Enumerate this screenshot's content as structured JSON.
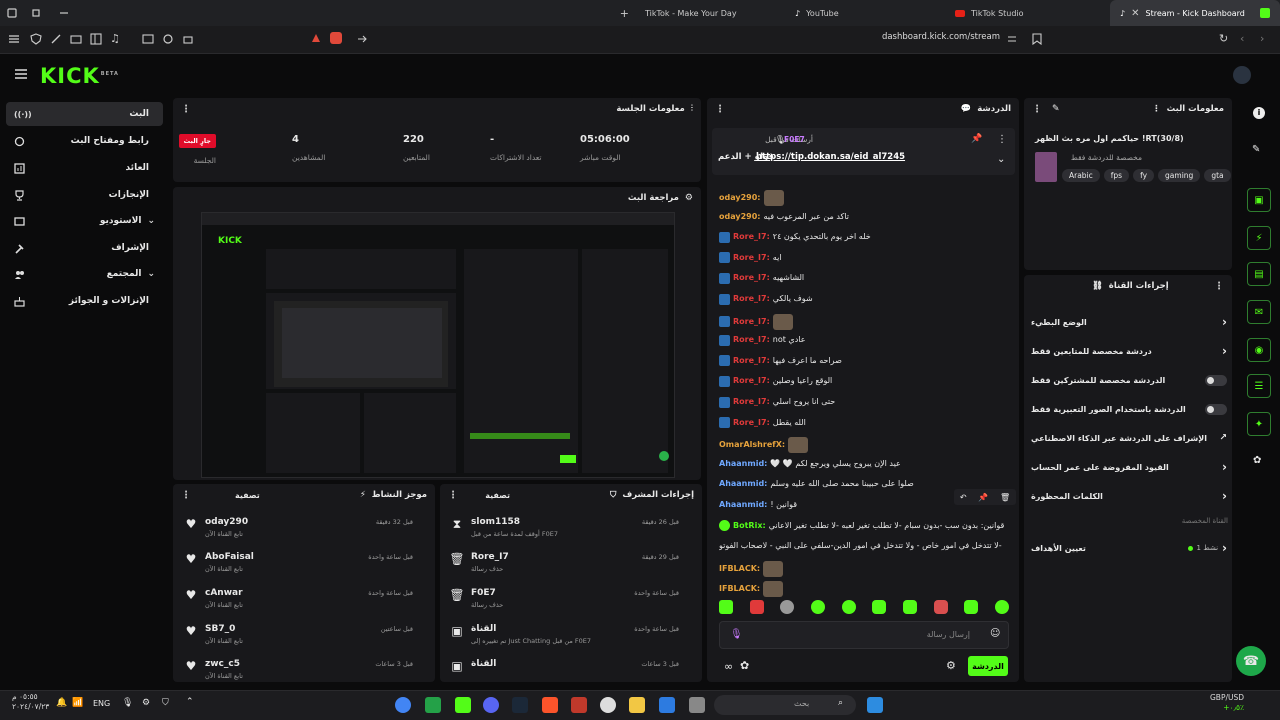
{
  "browser": {
    "tabs": [
      {
        "title": "TikTok - Make Your Day"
      },
      {
        "title": "YouTube"
      },
      {
        "title": "TikTok Studio"
      },
      {
        "title": "Stream - Kick Dashboard"
      }
    ],
    "url": "dashboard.kick.com/stream"
  },
  "brand": {
    "logo": "KICK",
    "beta": "BETA",
    "accent": "#53fc18"
  },
  "nav": {
    "items": [
      {
        "label": "البث",
        "icon": "live-icon"
      },
      {
        "label": "رابط ومفتاح البث",
        "icon": "link-icon"
      },
      {
        "label": "العائد",
        "icon": "chart-icon"
      },
      {
        "label": "الإنجازات",
        "icon": "trophy-icon"
      },
      {
        "label": "الاستوديو",
        "icon": "studio-icon"
      },
      {
        "label": "الإشراف",
        "icon": "hammer-icon"
      },
      {
        "label": "المجتمع",
        "icon": "community-icon"
      },
      {
        "label": "الإنزالات و الجوائز",
        "icon": "drops-icon"
      }
    ]
  },
  "session": {
    "title": "معلومات الجلسة",
    "live_badge": "جارٍ البث",
    "session_label": "الجلسة",
    "viewers_value": "4",
    "viewers_label": "المشاهدين",
    "followers_value": "220",
    "followers_label": "المتابعين",
    "subs_value": "-",
    "subs_label": "تعداد الاشتراكات",
    "uptime_value": "05:06:00",
    "uptime_label": "الوقت مباشر"
  },
  "preview": {
    "title": "مراجعة البث"
  },
  "activity": {
    "title": "موجز النشاط",
    "filter": "تصفية",
    "rows": [
      {
        "name": "oday290",
        "sub": "تابع القناة الآن",
        "time": "قبل 32 دقيقة"
      },
      {
        "name": "AboFaisal",
        "sub": "تابع القناة الآن",
        "time": "قبل ساعة واحدة"
      },
      {
        "name": "cAnwar",
        "sub": "تابع القناة الآن",
        "time": "قبل ساعة واحدة"
      },
      {
        "name": "SB7_0",
        "sub": "تابع القناة الآن",
        "time": "قبل ساعتين"
      },
      {
        "name": "zwc_c5",
        "sub": "تابع القناة الآن",
        "time": "قبل 3 ساعات"
      }
    ]
  },
  "modactions": {
    "title": "إجراءات المشرف",
    "filter": "تصفية",
    "rows": [
      {
        "name": "slom1158",
        "sub": "أوقف لمدة ساعة من قبل F0E7",
        "time": "قبل 26 دقيقة",
        "icon": "hourglass-icon"
      },
      {
        "name": "Rore_I7",
        "sub": "حذف رسالة",
        "time": "قبل 29 دقيقة",
        "icon": "trash-icon"
      },
      {
        "name": "F0E7",
        "sub": "حذف رسالة",
        "time": "قبل ساعة واحدة",
        "icon": "trash-icon"
      },
      {
        "name": "القناة",
        "sub": "تم تغييره إلى Just Chatting من قبل F0E7",
        "time": "قبل ساعة واحدة",
        "icon": "category-icon"
      },
      {
        "name": "القناة",
        "sub": "",
        "time": "قبل 3 ساعات",
        "icon": "category-icon"
      }
    ]
  },
  "chat": {
    "title": "الدردشة",
    "pinned": {
      "by": "أرسلت من قبل",
      "user": "F0E7",
      "text": "قولو + الدعم",
      "link": "https://tip.dokan.sa/eid_al7245"
    },
    "messages": [
      {
        "user": "oday290:",
        "text": "",
        "color": "#e6a23c",
        "badge": false
      },
      {
        "user": "oday290:",
        "text": "تاكد من عبر المرعوب فيه",
        "color": "#e6a23c",
        "badge": false
      },
      {
        "user": "Rore_I7:",
        "text": "خله اخر يوم بالتحدي يكون ٢٤",
        "color": "#e03a3a",
        "badge": true
      },
      {
        "user": "Rore_I7:",
        "text": "ايه",
        "color": "#e03a3a",
        "badge": true
      },
      {
        "user": "Rore_I7:",
        "text": "الشاشهيه",
        "color": "#e03a3a",
        "badge": true
      },
      {
        "user": "Rore_I7:",
        "text": "شوف يالكي",
        "color": "#e03a3a",
        "badge": true
      },
      {
        "user": "Rore_I7:",
        "text": "",
        "color": "#e03a3a",
        "badge": true
      },
      {
        "user": "Rore_I7:",
        "text": "عادي not",
        "color": "#e03a3a",
        "badge": true
      },
      {
        "user": "Rore_I7:",
        "text": "صراحه ما اعرف فيها",
        "color": "#e03a3a",
        "badge": true
      },
      {
        "user": "Rore_I7:",
        "text": "الوقع راعيا وصلين",
        "color": "#e03a3a",
        "badge": true
      },
      {
        "user": "Rore_I7:",
        "text": "حتى انا يروح اسلي",
        "color": "#e03a3a",
        "badge": true
      },
      {
        "user": "Rore_I7:",
        "text": "الله يقطل",
        "color": "#e03a3a",
        "badge": true
      },
      {
        "user": "OmarAlshrefX:",
        "text": "",
        "color": "#e6a23c",
        "badge": false
      },
      {
        "user": "Ahaanmid:",
        "text": "عيد الإن يبروح يسلي ويرجع لكم 🤍 🤍",
        "color": "#6fa8ff",
        "badge": false
      },
      {
        "user": "Ahaanmid:",
        "text": "صلوا على حبيبنا محمد صلى الله عليه وسلم",
        "color": "#6fa8ff",
        "badge": false
      },
      {
        "user": "Ahaanmid:",
        "text": "قوانين !",
        "color": "#6fa8ff",
        "badge": false
      },
      {
        "user": "BotRix:",
        "text": "قوانين: بدون سب -بدون سبام -لا تطلب تغير لعبه -لا تطلب تغير الاعاني",
        "color": "#53fc18",
        "badge": true
      },
      {
        "user": "",
        "text": "-لا تتدخل في امور خاص - ولا تتدخل في امور الدين-سلفي على النبي - لاصحاب الفوتو",
        "color": "#e8e8e8",
        "badge": false
      },
      {
        "user": "IFBLACK:",
        "text": "",
        "color": "#e6a23c",
        "badge": false
      },
      {
        "user": "IFBLACK:",
        "text": "",
        "color": "#e6a23c",
        "badge": false
      }
    ],
    "input_placeholder": "إرسال رسالة",
    "send_label": "الدردشة"
  },
  "streaminfo": {
    "title": "معلومات البث",
    "stream_title": "حياكمم اول مره بث الظهر !RT(30/8)",
    "category": "مخصصة للدردشة فقط",
    "tags": [
      "Arabic",
      "fps",
      "fy",
      "gaming",
      "gta"
    ]
  },
  "channelactions": {
    "title": "إجراءات القناة",
    "items": [
      {
        "label": "الوضع البطيء",
        "control": "chevron"
      },
      {
        "label": "دردشة مخصصة للمتابعين فقط",
        "control": "chevron"
      },
      {
        "label": "الدردشة مخصصة للمشتركين فقط",
        "control": "toggle"
      },
      {
        "label": "الدردشة باستخدام الصور التعبيرية فقط",
        "control": "toggle"
      },
      {
        "label": "الإشراف على الدردشة عبر الذكاء الاصطناعي",
        "control": "external"
      },
      {
        "label": "القيود المفروضة على عمر الحساب",
        "control": "chevron"
      },
      {
        "label": "الكلمات المحظورة",
        "control": "chevron"
      }
    ],
    "section_label": "القناة المخصصة",
    "goals_label": "تعيين الأهداف",
    "goals_value": "نشط 1"
  },
  "taskbar": {
    "time": "٠٥:٥٥ م",
    "date": "٢٠٢٤/٠٧/٢٣",
    "lang": "ENG",
    "search_placeholder": "بحث",
    "currency": "GBP/USD",
    "currency_change": "+٠٫٥٪"
  }
}
